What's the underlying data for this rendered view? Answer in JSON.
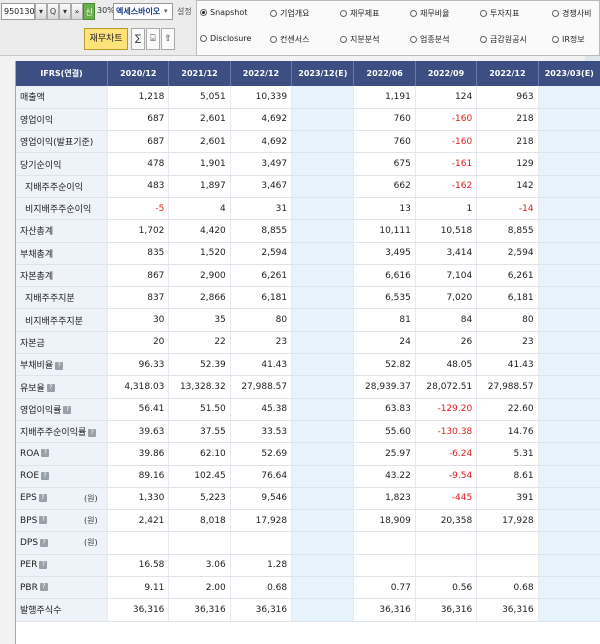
{
  "toolbar": {
    "code": "950130",
    "dropdown_glyph": "▾",
    "search_glyph": "Q",
    "quick_glyph": "▾",
    "arrow_glyph": "»",
    "green_label": "신",
    "zoom": "30%",
    "company_name": "엑세스바이오",
    "settings_label": "설정",
    "fin_chart_label": "재무차트",
    "icon_btn_1": "∑",
    "icon_btn_2": "⌸",
    "icon_btn_3": "⇧"
  },
  "radios": [
    {
      "label": "Snapshot",
      "selected": true
    },
    {
      "label": "기업개요",
      "selected": false
    },
    {
      "label": "재무제표",
      "selected": false
    },
    {
      "label": "재무비율",
      "selected": false
    },
    {
      "label": "투자지표",
      "selected": false
    },
    {
      "label": "경쟁사비",
      "selected": false
    },
    {
      "label": "Disclosure",
      "selected": false
    },
    {
      "label": "컨센서스",
      "selected": false
    },
    {
      "label": "지분분석",
      "selected": false
    },
    {
      "label": "업종분석",
      "selected": false
    },
    {
      "label": "금감원공시",
      "selected": false
    },
    {
      "label": "IR정보",
      "selected": false
    }
  ],
  "table": {
    "head_label": "IFRS(연결)",
    "columns": [
      "2020/12",
      "2021/12",
      "2022/12",
      "2023/12(E)",
      "2022/06",
      "2022/09",
      "2022/12",
      "2023/03(E)"
    ],
    "rows": [
      {
        "label": "매출액",
        "sub": false,
        "help": false,
        "unit": "",
        "values": [
          "1,218",
          "5,051",
          "10,339",
          "",
          "1,191",
          "124",
          "963",
          ""
        ]
      },
      {
        "label": "영업이익",
        "sub": false,
        "help": false,
        "unit": "",
        "values": [
          "687",
          "2,601",
          "4,692",
          "",
          "760",
          "-160",
          "218",
          ""
        ]
      },
      {
        "label": "영업이익(발표기준)",
        "sub": false,
        "help": false,
        "unit": "",
        "values": [
          "687",
          "2,601",
          "4,692",
          "",
          "760",
          "-160",
          "218",
          ""
        ]
      },
      {
        "label": "당기순이익",
        "sub": false,
        "help": false,
        "unit": "",
        "values": [
          "478",
          "1,901",
          "3,497",
          "",
          "675",
          "-161",
          "129",
          ""
        ]
      },
      {
        "label": "지배주주순이익",
        "sub": true,
        "help": false,
        "unit": "",
        "values": [
          "483",
          "1,897",
          "3,467",
          "",
          "662",
          "-162",
          "142",
          ""
        ]
      },
      {
        "label": "비지배주주순이익",
        "sub": true,
        "help": false,
        "unit": "",
        "values": [
          "-5",
          "4",
          "31",
          "",
          "13",
          "1",
          "-14",
          ""
        ]
      },
      {
        "label": "자산총계",
        "sub": false,
        "help": false,
        "unit": "",
        "values": [
          "1,702",
          "4,420",
          "8,855",
          "",
          "10,111",
          "10,518",
          "8,855",
          ""
        ]
      },
      {
        "label": "부채총계",
        "sub": false,
        "help": false,
        "unit": "",
        "values": [
          "835",
          "1,520",
          "2,594",
          "",
          "3,495",
          "3,414",
          "2,594",
          ""
        ]
      },
      {
        "label": "자본총계",
        "sub": false,
        "help": false,
        "unit": "",
        "values": [
          "867",
          "2,900",
          "6,261",
          "",
          "6,616",
          "7,104",
          "6,261",
          ""
        ]
      },
      {
        "label": "지배주주지분",
        "sub": true,
        "help": false,
        "unit": "",
        "values": [
          "837",
          "2,866",
          "6,181",
          "",
          "6,535",
          "7,020",
          "6,181",
          ""
        ]
      },
      {
        "label": "비지배주주지분",
        "sub": true,
        "help": false,
        "unit": "",
        "values": [
          "30",
          "35",
          "80",
          "",
          "81",
          "84",
          "80",
          ""
        ]
      },
      {
        "label": "자본금",
        "sub": false,
        "help": false,
        "unit": "",
        "values": [
          "20",
          "22",
          "23",
          "",
          "24",
          "26",
          "23",
          ""
        ]
      },
      {
        "label": "부채비율",
        "sub": false,
        "help": true,
        "unit": "",
        "values": [
          "96.33",
          "52.39",
          "41.43",
          "",
          "52.82",
          "48.05",
          "41.43",
          ""
        ]
      },
      {
        "label": "유보율",
        "sub": false,
        "help": true,
        "unit": "",
        "values": [
          "4,318.03",
          "13,328.32",
          "27,988.57",
          "",
          "28,939.37",
          "28,072.51",
          "27,988.57",
          ""
        ]
      },
      {
        "label": "영업이익률",
        "sub": false,
        "help": true,
        "unit": "",
        "values": [
          "56.41",
          "51.50",
          "45.38",
          "",
          "63.83",
          "-129.20",
          "22.60",
          ""
        ]
      },
      {
        "label": "지배주주순이익률",
        "sub": false,
        "help": true,
        "unit": "",
        "values": [
          "39.63",
          "37.55",
          "33.53",
          "",
          "55.60",
          "-130.38",
          "14.76",
          ""
        ]
      },
      {
        "label": "ROA",
        "sub": false,
        "help": true,
        "unit": "",
        "values": [
          "39.86",
          "62.10",
          "52.69",
          "",
          "25.97",
          "-6.24",
          "5.31",
          ""
        ]
      },
      {
        "label": "ROE",
        "sub": false,
        "help": true,
        "unit": "",
        "values": [
          "89.16",
          "102.45",
          "76.64",
          "",
          "43.22",
          "-9.54",
          "8.61",
          ""
        ]
      },
      {
        "label": "EPS",
        "sub": false,
        "help": true,
        "unit": "(원)",
        "values": [
          "1,330",
          "5,223",
          "9,546",
          "",
          "1,823",
          "-445",
          "391",
          ""
        ]
      },
      {
        "label": "BPS",
        "sub": false,
        "help": true,
        "unit": "(원)",
        "values": [
          "2,421",
          "8,018",
          "17,928",
          "",
          "18,909",
          "20,358",
          "17,928",
          ""
        ]
      },
      {
        "label": "DPS",
        "sub": false,
        "help": true,
        "unit": "(원)",
        "values": [
          "",
          "",
          "",
          "",
          "",
          "",
          "",
          ""
        ]
      },
      {
        "label": "PER",
        "sub": false,
        "help": true,
        "unit": "",
        "values": [
          "16.58",
          "3.06",
          "1.28",
          "",
          "",
          "",
          "",
          ""
        ]
      },
      {
        "label": "PBR",
        "sub": false,
        "help": true,
        "unit": "",
        "values": [
          "9.11",
          "2.00",
          "0.68",
          "",
          "0.77",
          "0.56",
          "0.68",
          ""
        ]
      },
      {
        "label": "발행주식수",
        "sub": false,
        "help": false,
        "unit": "",
        "values": [
          "36,316",
          "36,316",
          "36,316",
          "",
          "36,316",
          "36,316",
          "36,316",
          ""
        ]
      }
    ]
  },
  "colors": {
    "header_bg": "#3d4f82",
    "label_bg": "#eef2f9",
    "estimate_bg": "#e6f3fa",
    "negative": "#e21b1b",
    "fin_chart_btn": "#ffe27a"
  }
}
